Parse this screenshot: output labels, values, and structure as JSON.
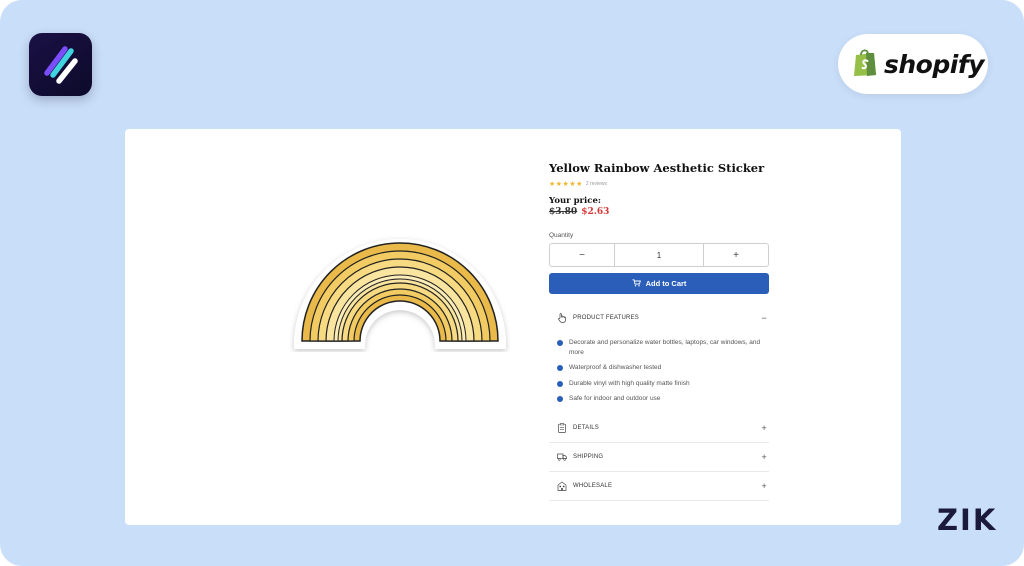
{
  "branding": {
    "platform_name": "shopify",
    "watermark": "ZIK",
    "app_icon": "app-logo-icon",
    "shopify_icon": "shopify-bag-icon"
  },
  "product": {
    "title": "Yellow Rainbow Aesthetic Sticker",
    "stars": "★★★★★",
    "review_count": "2 reviews",
    "price_label": "Your price:",
    "old_price": "$3.80",
    "new_price": "$2.63",
    "quantity_label": "Quantity",
    "quantity_value": "1",
    "decrement": "−",
    "increment": "+",
    "add_to_cart": "Add to Cart"
  },
  "accordion": {
    "features": {
      "label": "PRODUCT FEATURES",
      "toggle": "−",
      "icon": "hand-icon",
      "items": [
        "Decorate and personalize water bottles, laptops, car windows, and more",
        "Waterproof & dishwasher tested",
        "Durable vinyl with high quality matte finish",
        "Safe for indoor and outdoor use"
      ]
    },
    "details": {
      "label": "DETAILS",
      "toggle": "+",
      "icon": "clipboard-icon"
    },
    "shipping": {
      "label": "SHIPPING",
      "toggle": "+",
      "icon": "truck-icon"
    },
    "wholesale": {
      "label": "WHOLESALE",
      "toggle": "+",
      "icon": "building-icon"
    }
  },
  "colors": {
    "background": "#c9def9",
    "accent_blue": "#2a5eb8",
    "sale_red": "#d93838",
    "star_yellow": "#f2b62c",
    "shopify_green": "#95bf47"
  }
}
